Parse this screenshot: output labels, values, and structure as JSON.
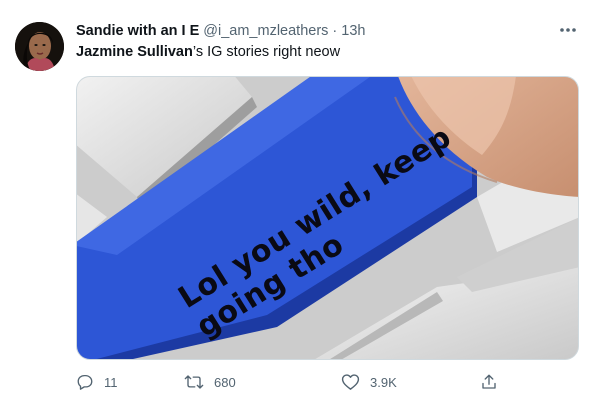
{
  "tweet": {
    "author": {
      "display_name": "Sandie with an I E",
      "handle": "@i_am_mzleathers",
      "avatar_icon": "profile-photo"
    },
    "separator": "·",
    "time": "13h",
    "text": {
      "mention": "Jazmine Sullivan",
      "rest": "’s IG stories right neow"
    },
    "media": {
      "lines": [
        "Lol you wild, keep",
        "going tho"
      ],
      "button_color": "#2d56d6"
    },
    "more_icon": "more-horizontal-icon",
    "actions": {
      "reply": {
        "icon": "reply-icon",
        "count": "11"
      },
      "retweet": {
        "icon": "retweet-icon",
        "count": "680"
      },
      "like": {
        "icon": "heart-icon",
        "count": "3.9K"
      },
      "share": {
        "icon": "share-icon"
      }
    }
  }
}
